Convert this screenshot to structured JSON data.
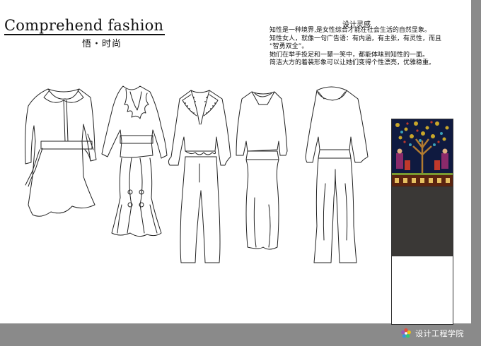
{
  "header": {
    "title": "Comprehend fashion",
    "subtitle": "悟・时尚"
  },
  "inspiration": {
    "title": "设计灵感",
    "lines": [
      "知性是一种境界,是女性综合才能在社会生活的自然显象。",
      " 知性女人，就像一句广告语：有内涵，有主张，有灵性，而且",
      "“智勇双全”。",
      "她们在举手投足和一颦一笑中，都能体味到知性的一面。",
      "简洁大方的着装形象可以让她们变得个性漂亮，优雅稳重。"
    ]
  },
  "footer": {
    "label": "设计工程学院",
    "logo_icon": "flower-logo-icon"
  },
  "colors": {
    "background": "#8a8a8a",
    "sheet": "#ffffff",
    "fabric_base": "#0f1a40",
    "swatch_dark": "#3a3836",
    "swatch_light": "#ffffff"
  }
}
